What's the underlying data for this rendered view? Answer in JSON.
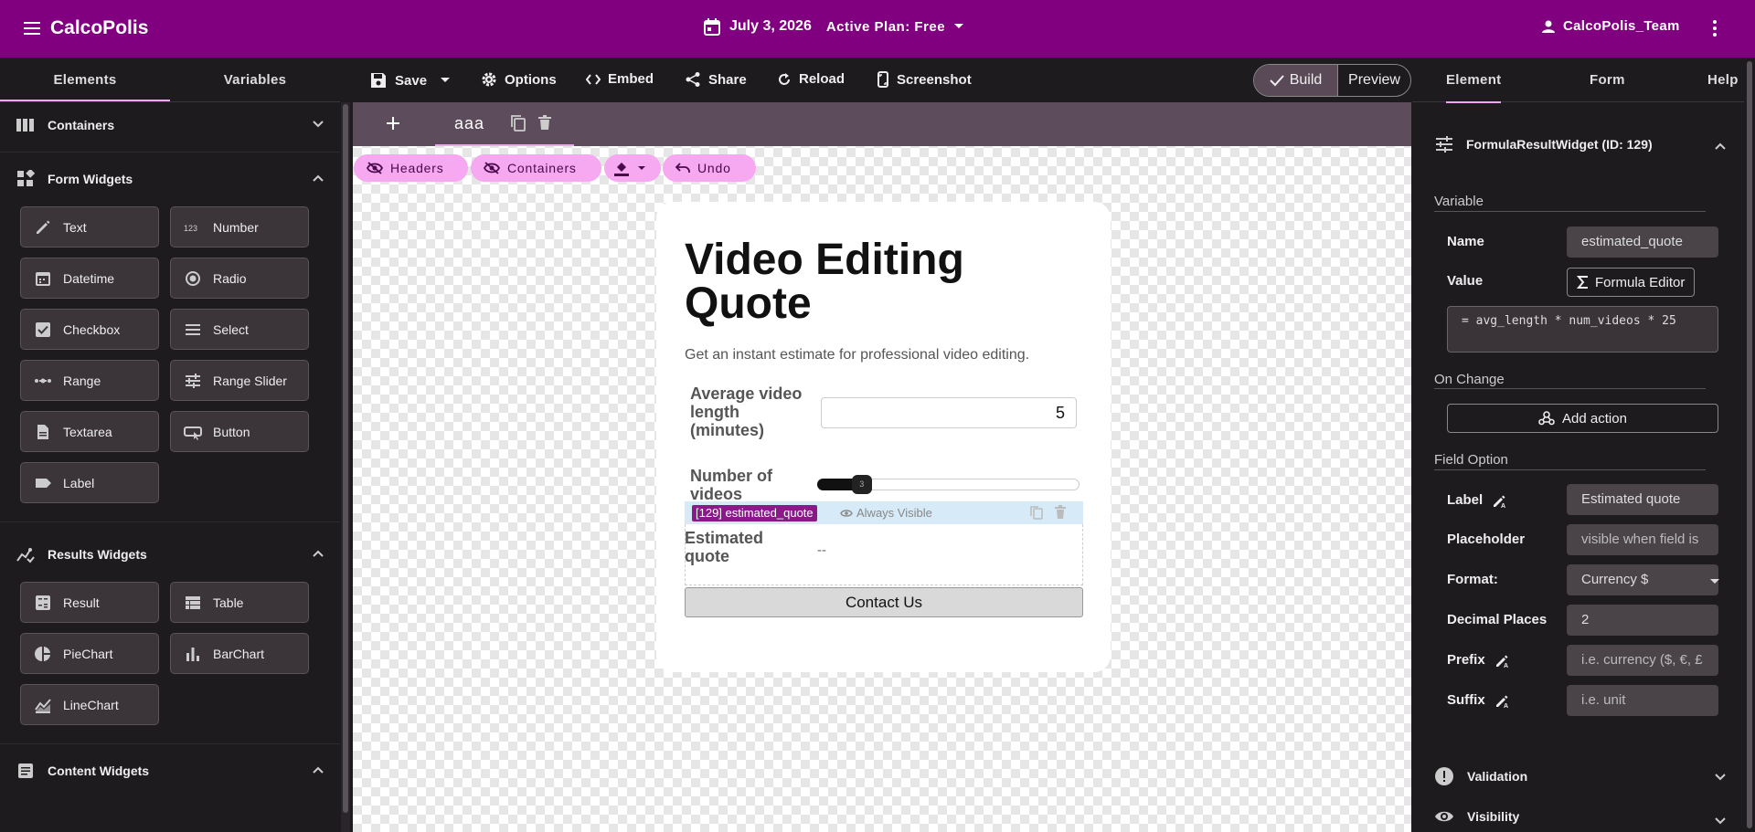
{
  "app": {
    "title": "CalcoPolis",
    "date": "July 3, 2026",
    "plan": "Active Plan: Free",
    "user": "CalcoPolis_Team"
  },
  "left_tabs": [
    "Elements",
    "Variables"
  ],
  "sections": {
    "containers": "Containers",
    "form_widgets": "Form Widgets",
    "results_widgets": "Results Widgets",
    "content_widgets": "Content Widgets"
  },
  "form_widgets": [
    {
      "label": "Text",
      "icon": "pencil-icon"
    },
    {
      "label": "Number",
      "icon": "number-icon"
    },
    {
      "label": "Datetime",
      "icon": "calendar-icon"
    },
    {
      "label": "Radio",
      "icon": "radio-icon"
    },
    {
      "label": "Checkbox",
      "icon": "checkbox-icon"
    },
    {
      "label": "Select",
      "icon": "list-icon"
    },
    {
      "label": "Range",
      "icon": "range-icon"
    },
    {
      "label": "Range Slider",
      "icon": "sliders-icon"
    },
    {
      "label": "Textarea",
      "icon": "document-icon"
    },
    {
      "label": "Button",
      "icon": "button-icon"
    },
    {
      "label": "Label",
      "icon": "label-icon"
    }
  ],
  "results_widgets": [
    {
      "label": "Result",
      "icon": "calculator-icon"
    },
    {
      "label": "Table",
      "icon": "table-icon"
    },
    {
      "label": "PieChart",
      "icon": "pie-chart-icon"
    },
    {
      "label": "BarChart",
      "icon": "bar-chart-icon"
    },
    {
      "label": "LineChart",
      "icon": "line-chart-icon"
    }
  ],
  "toolbar": {
    "save": "Save",
    "options": "Options",
    "embed": "Embed",
    "share": "Share",
    "reload": "Reload",
    "screenshot": "Screenshot",
    "build": "Build",
    "preview": "Preview"
  },
  "page_tab": "aaa",
  "chips": {
    "headers": "Headers",
    "containers": "Containers",
    "undo": "Undo"
  },
  "form": {
    "title": "Video Editing Quote",
    "description": "Get an instant estimate for professional video editing.",
    "avg_length_label": "Average video length (minutes)",
    "avg_length_value": "5",
    "num_videos_label": "Number of videos",
    "num_videos_value": "3",
    "num_videos_fraction": 0.17,
    "selected_tag": "[129] estimated_quote",
    "visibility": "Always Visible",
    "estimated_label": "Estimated quote",
    "estimated_value": "--",
    "contact_button": "Contact Us"
  },
  "right_tabs": [
    "Element",
    "Form",
    "Help"
  ],
  "inspector": {
    "widget_title": "FormulaResultWidget (ID: 129)",
    "variable_group": "Variable",
    "name_label": "Name",
    "name_value": "estimated_quote",
    "value_label": "Value",
    "formula_editor": "Formula Editor",
    "formula": "= avg_length * num_videos * 25",
    "on_change_group": "On Change",
    "add_action": "Add action",
    "field_option_group": "Field Option",
    "label_label": "Label",
    "label_value": "Estimated quote",
    "placeholder_label": "Placeholder",
    "placeholder_value": "visible when field is",
    "format_label": "Format:",
    "format_value": "Currency $",
    "decimal_label": "Decimal Places",
    "decimal_value": "2",
    "prefix_label": "Prefix",
    "prefix_placeholder": "i.e. currency ($, €, £",
    "suffix_label": "Suffix",
    "suffix_placeholder": "i.e. unit",
    "validation": "Validation",
    "visibility": "Visibility"
  },
  "colors": {
    "brand": "#800080",
    "accent": "#f2a6f2",
    "chip": "#f6a8f0",
    "panel": "#1e1b1e"
  }
}
